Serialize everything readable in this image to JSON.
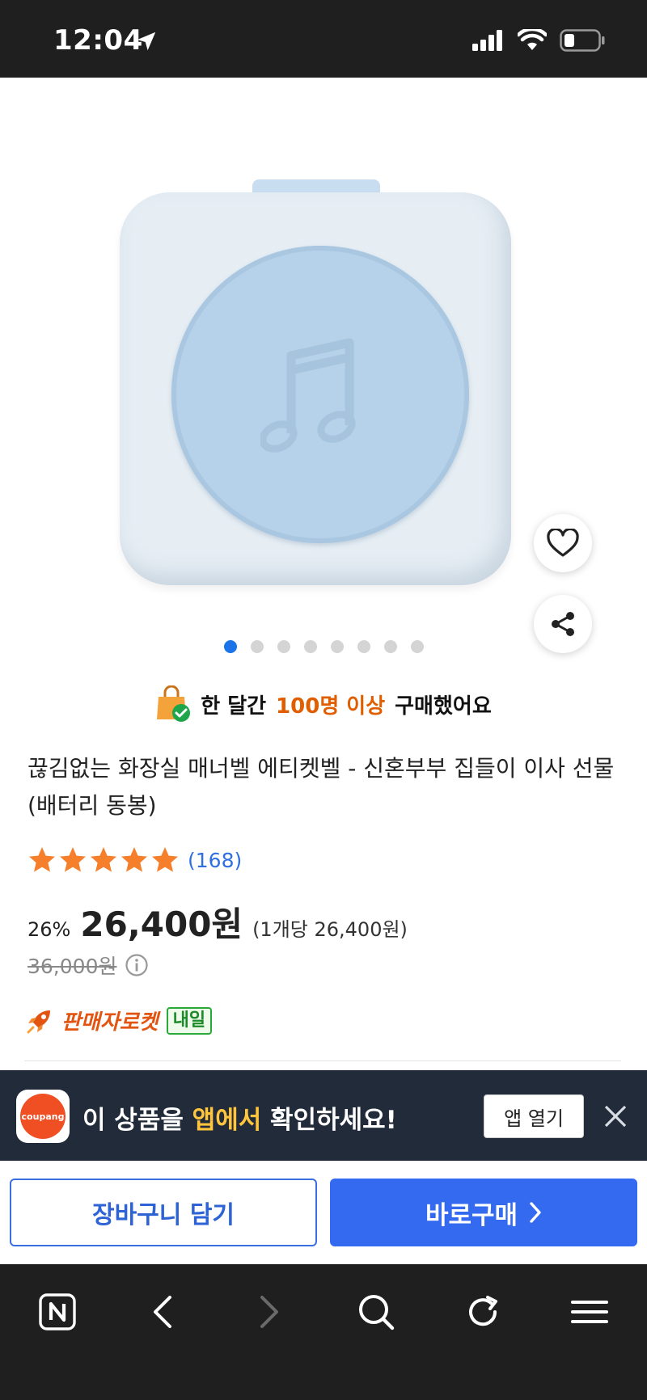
{
  "status_bar": {
    "time": "12:04"
  },
  "product": {
    "image_count": 8,
    "active_image_index": 0
  },
  "purchase_notice": {
    "prefix": "한 달간",
    "highlight": "100명 이상",
    "suffix": "구매했어요"
  },
  "title": "끊김없는 화장실 매너벨 에티켓벨 - 신혼부부 집들이 이사 선물 (배터리 동봉)",
  "rating": {
    "stars": 5,
    "max_stars": 5,
    "review_count": "(168)"
  },
  "price": {
    "discount": "26%",
    "sale_price": "26,400원",
    "unit_price": "(1개당 26,400원)",
    "original_price": "36,000원"
  },
  "delivery": {
    "seller_label": "판매자로켓",
    "badge": "내일"
  },
  "app_banner": {
    "logo_text": "coupang",
    "text_prefix": "이 상품을",
    "text_highlight": "앱에서",
    "text_suffix": "확인하세요!",
    "open_button": "앱 열기"
  },
  "actions": {
    "cart": "장바구니 담기",
    "buy": "바로구매"
  },
  "colors": {
    "accent_blue": "#346aef",
    "highlight_orange": "#e05e00",
    "banner_bg": "#222b3a",
    "banner_highlight": "#ffc53d",
    "star_orange": "#f57f2a"
  },
  "icons": [
    "location-arrow-icon",
    "signal-icon",
    "wifi-icon",
    "battery-icon",
    "heart-icon",
    "share-icon",
    "shopping-bag-check-icon",
    "star-icon",
    "info-icon",
    "rocket-icon",
    "close-icon",
    "chevron-right-icon",
    "naver-icon",
    "back-icon",
    "forward-icon",
    "search-icon",
    "refresh-icon",
    "menu-icon"
  ]
}
